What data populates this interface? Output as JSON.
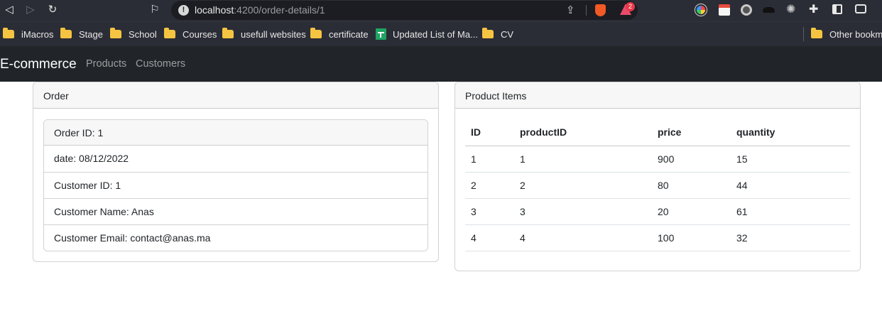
{
  "browser": {
    "url_host": "localhost",
    "url_path": ":4200/order-details/1",
    "rewards_badge": "2",
    "bookmarks": [
      {
        "label": "iMacros",
        "icon": "folder-icon"
      },
      {
        "label": "Stage",
        "icon": "folder-icon"
      },
      {
        "label": "School",
        "icon": "folder-icon"
      },
      {
        "label": "Courses",
        "icon": "folder-icon"
      },
      {
        "label": "usefull websites",
        "icon": "folder-icon"
      },
      {
        "label": "certificate",
        "icon": "folder-icon"
      },
      {
        "label": "Updated List of Ma...",
        "icon": "sheets-icon"
      },
      {
        "label": "CV",
        "icon": "folder-icon"
      }
    ],
    "other_bookmarks": "Other bookma"
  },
  "navbar": {
    "brand": "E-commerce",
    "links": [
      "Products",
      "Customers"
    ]
  },
  "order_card": {
    "header": "Order",
    "order_id": "Order ID: 1",
    "items": [
      "date: 08/12/2022",
      "Customer ID: 1",
      "Customer Name: Anas",
      "Customer Email: contact@anas.ma"
    ]
  },
  "products_card": {
    "header": "Product Items",
    "columns": [
      "ID",
      "productID",
      "price",
      "quantity"
    ],
    "rows": [
      [
        "1",
        "1",
        "900",
        "15"
      ],
      [
        "2",
        "2",
        "80",
        "44"
      ],
      [
        "3",
        "3",
        "20",
        "61"
      ],
      [
        "4",
        "4",
        "100",
        "32"
      ]
    ]
  },
  "colors": {
    "navbar_bg": "#212529",
    "browser_bg": "#2b2d36",
    "folder": "#f5c542"
  }
}
